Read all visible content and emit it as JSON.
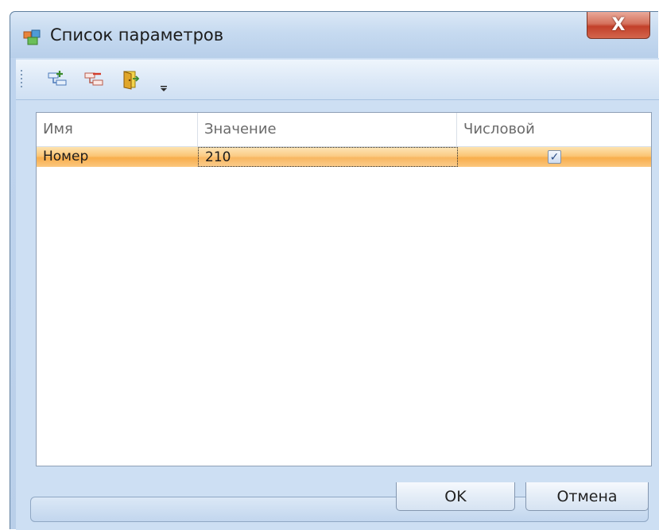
{
  "window": {
    "title": "Список параметров",
    "close_label": "X",
    "icon": "form-window-icon"
  },
  "toolbar": {
    "buttons": [
      {
        "name": "add-parameter-icon"
      },
      {
        "name": "remove-parameter-icon"
      },
      {
        "name": "exit-door-icon"
      }
    ],
    "overflow_icon": "chevron-down-icon"
  },
  "grid": {
    "columns": [
      "Имя",
      "Значение",
      "Числовой"
    ],
    "rows": [
      {
        "name": "Номер",
        "value": "210",
        "numeric": true,
        "checkmark": "✓"
      }
    ]
  },
  "buttons": {
    "ok": "OK",
    "cancel": "Отмена"
  },
  "colors": {
    "selected_row": "#fbc575",
    "close_button": "#c2402a",
    "frame": "#bfd4ee"
  }
}
